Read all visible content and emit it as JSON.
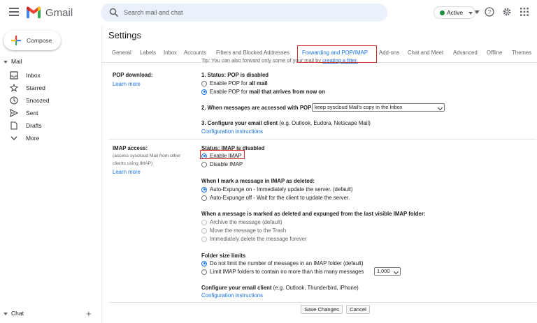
{
  "header": {
    "app_name": "Gmail",
    "search_placeholder": "Search mail and chat",
    "status": "Active",
    "status_color": "#1e8e3e"
  },
  "sidebar": {
    "compose": "Compose",
    "section_mail": "Mail",
    "items": [
      {
        "label": "Inbox",
        "icon": "inbox-icon"
      },
      {
        "label": "Starred",
        "icon": "star-icon"
      },
      {
        "label": "Snoozed",
        "icon": "clock-icon"
      },
      {
        "label": "Sent",
        "icon": "send-icon"
      },
      {
        "label": "Drafts",
        "icon": "draft-icon"
      },
      {
        "label": "More",
        "icon": "chevron-down-icon"
      }
    ],
    "section_chat": "Chat"
  },
  "main": {
    "title": "Settings",
    "tabs": [
      {
        "label": "General"
      },
      {
        "label": "Labels"
      },
      {
        "label": "Inbox"
      },
      {
        "label": "Accounts"
      },
      {
        "label": "Filters and Blocked Addresses"
      },
      {
        "label": "Forwarding and POP/IMAP"
      },
      {
        "label": "Add-ons"
      },
      {
        "label": "Chat and Meet"
      },
      {
        "label": "Advanced"
      },
      {
        "label": "Offline"
      },
      {
        "label": "Themes"
      }
    ],
    "active_tab": "Forwarding and POP/IMAP",
    "scroll_fragment": "Tip: You can also forward only some of your mail by",
    "scroll_fragment_link": "creating a filter.",
    "pop": {
      "title": "POP download:",
      "learn_more": "Learn more",
      "status_label": "1. Status: POP is disabled",
      "opt1_prefix": "Enable POP for ",
      "opt1_bold": "all mail",
      "opt2_prefix": "Enable POP for ",
      "opt2_bold": "mail that arrives from now on",
      "access_label": "2. When messages are accessed with POP",
      "access_value": "keep syscloud Mail's copy in the Inbox",
      "configure_bold": "3. Configure your email client",
      "configure_rest": " (e.g. Outlook, Eudora, Netscape Mail)",
      "config_link": "Configuration instructions"
    },
    "imap": {
      "title": "IMAP access:",
      "note": "(access syscloud Mail from other clients using IMAP)",
      "learn_more": "Learn more",
      "status_label": "Status: IMAP is disabled",
      "enable": "Enable IMAP",
      "disable": "Disable IMAP",
      "deleted_hdr": "When I mark a message in IMAP as deleted:",
      "expunge_on": "Auto-Expunge on - Immediately update the server. (default)",
      "expunge_off": "Auto-Expunge off - Wait for the client to update the server.",
      "expunged_hdr": "When a message is marked as deleted and expunged from the last visible IMAP folder:",
      "archive": "Archive the message (default)",
      "trash": "Move the message to the Trash",
      "delete_forever": "Immediately delete the message forever",
      "folder_hdr": "Folder size limits",
      "no_limit": "Do not limit the number of messages in an IMAP folder (default)",
      "limit": "Limit IMAP folders to contain no more than this many messages",
      "limit_value": "1,000",
      "configure_bold": "Configure your email client",
      "configure_rest": " (e.g. Outlook, Thunderbird, iPhone)",
      "config_link": "Configuration instructions"
    },
    "save": "Save Changes",
    "cancel": "Cancel"
  }
}
